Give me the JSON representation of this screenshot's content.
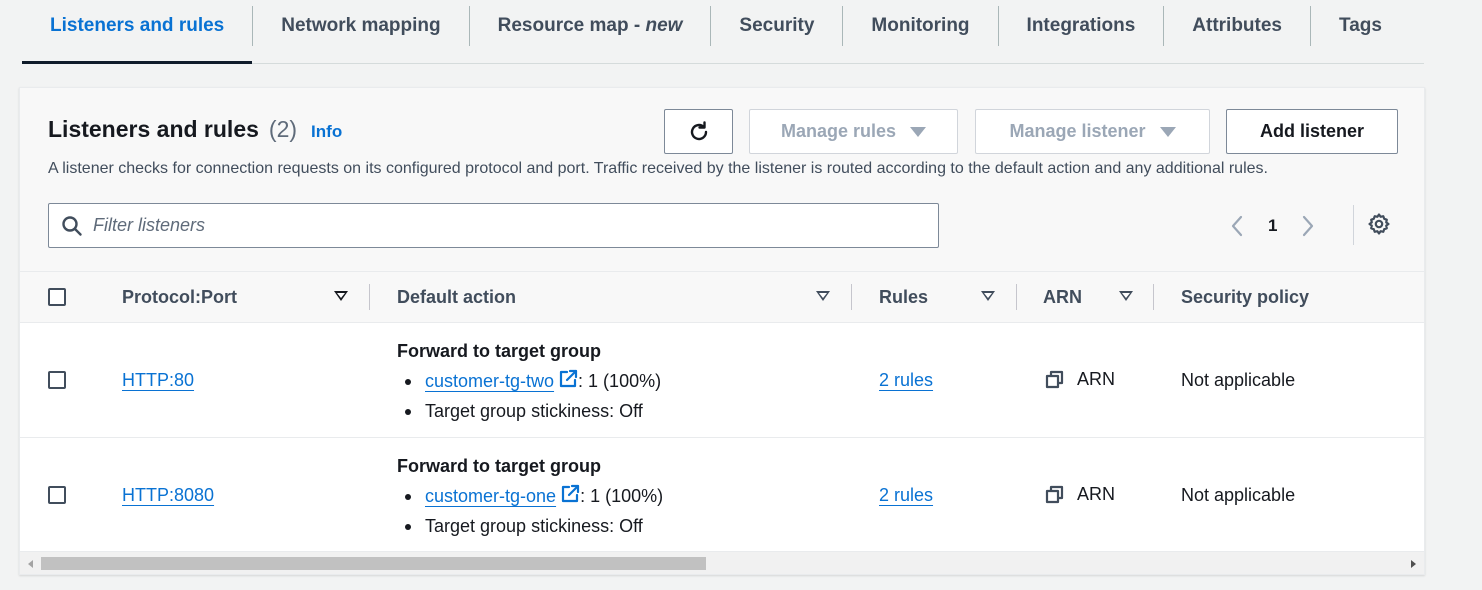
{
  "tabs": [
    {
      "label": "Listeners and rules",
      "active": true
    },
    {
      "label": "Network mapping"
    },
    {
      "label": "Resource map - ",
      "suffix": "new"
    },
    {
      "label": "Security"
    },
    {
      "label": "Monitoring"
    },
    {
      "label": "Integrations"
    },
    {
      "label": "Attributes"
    },
    {
      "label": "Tags"
    }
  ],
  "panel": {
    "title": "Listeners and rules",
    "count": "(2)",
    "info": "Info",
    "description": "A listener checks for connection requests on its configured protocol and port. Traffic received by the listener is routed according to the default action and any additional rules.",
    "buttons": {
      "refresh_icon": "refresh-icon",
      "manage_rules": "Manage rules",
      "manage_listener": "Manage listener",
      "add_listener": "Add listener"
    },
    "search": {
      "placeholder": "Filter listeners",
      "value": ""
    },
    "pagination": {
      "current_page": "1"
    }
  },
  "table": {
    "columns": [
      "Protocol:Port",
      "Default action",
      "Rules",
      "ARN",
      "Security policy"
    ],
    "rows": [
      {
        "protocol_port": "HTTP:80",
        "action_title": "Forward to target group",
        "target_group": "customer-tg-two",
        "weight": ": 1 (100%)",
        "stickiness": "Target group stickiness: Off",
        "rules": "2 rules",
        "arn": "ARN",
        "security_policy": "Not applicable"
      },
      {
        "protocol_port": "HTTP:8080",
        "action_title": "Forward to target group",
        "target_group": "customer-tg-one",
        "weight": ": 1 (100%)",
        "stickiness": "Target group stickiness: Off",
        "rules": "2 rules",
        "arn": "ARN",
        "security_policy": "Not applicable"
      }
    ]
  },
  "colors": {
    "link": "#0972d3",
    "text": "#16191f",
    "muted": "#5f6b7a",
    "header_bg": "#f8f8f8"
  }
}
